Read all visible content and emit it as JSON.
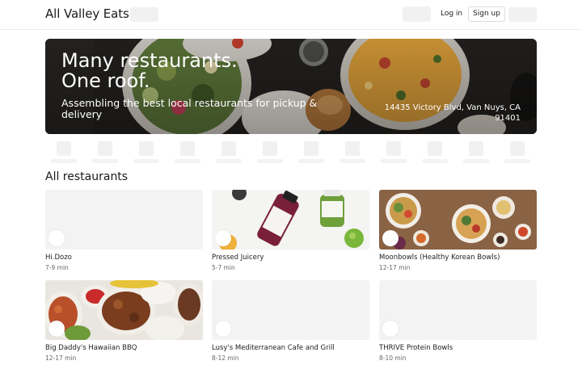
{
  "header": {
    "brand": "All Valley Eats",
    "login_label": "Log in",
    "signup_label": "Sign up"
  },
  "hero": {
    "title_line1": "Many restaurants.",
    "title_line2": "One roof.",
    "subtitle": "Assembling the best local restaurants for pickup & delivery",
    "address": "14435 Victory Blvd, Van Nuys, CA 91401"
  },
  "section": {
    "title": "All restaurants"
  },
  "restaurants": [
    {
      "name": "Hi.Dozo",
      "eta": "7-9 min"
    },
    {
      "name": "Pressed Juicery",
      "eta": "5-7 min"
    },
    {
      "name": "Moonbowls (Healthy Korean Bowls)",
      "eta": "12-17 min"
    },
    {
      "name": "Big Daddy's Hawaiian BBQ",
      "eta": "12-17 min"
    },
    {
      "name": "Lusy's Mediterranean Cafe and Grill",
      "eta": "8-12 min"
    },
    {
      "name": "THRIVE Protein Bowls",
      "eta": "8-10 min"
    }
  ]
}
